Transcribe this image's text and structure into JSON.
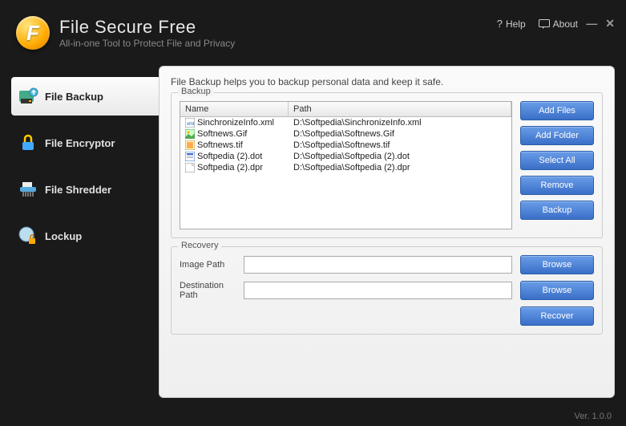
{
  "app": {
    "title": "File Secure Free",
    "subtitle": "All-in-one Tool to Protect File and Privacy",
    "help": "Help",
    "about": "About"
  },
  "sidebar": {
    "items": [
      {
        "label": "File Backup"
      },
      {
        "label": "File Encryptor"
      },
      {
        "label": "File Shredder"
      },
      {
        "label": "Lockup"
      }
    ]
  },
  "panel": {
    "desc": "File Backup helps you to backup personal data and keep it safe.",
    "backup_title": "Backup",
    "recovery_title": "Recovery",
    "columns": {
      "name": "Name",
      "path": "Path"
    },
    "files": [
      {
        "name": "SinchronizeInfo.xml",
        "path": "D:\\Softpedia\\SinchronizeInfo.xml",
        "icon": "xml"
      },
      {
        "name": "Softnews.Gif",
        "path": "D:\\Softpedia\\Softnews.Gif",
        "icon": "gif"
      },
      {
        "name": "Softnews.tif",
        "path": "D:\\Softpedia\\Softnews.tif",
        "icon": "tif"
      },
      {
        "name": "Softpedia (2).dot",
        "path": "D:\\Softpedia\\Softpedia (2).dot",
        "icon": "dot"
      },
      {
        "name": "Softpedia (2).dpr",
        "path": "D:\\Softpedia\\Softpedia (2).dpr",
        "icon": "dpr"
      }
    ],
    "buttons": {
      "add_files": "Add Files",
      "add_folder": "Add Folder",
      "select_all": "Select All",
      "remove": "Remove",
      "backup": "Backup",
      "browse": "Browse",
      "recover": "Recover"
    },
    "recovery": {
      "image_path_label": "Image Path",
      "image_path_value": "",
      "dest_path_label": "Destination Path",
      "dest_path_value": ""
    }
  },
  "footer": {
    "version": "Ver. 1.0.0"
  }
}
